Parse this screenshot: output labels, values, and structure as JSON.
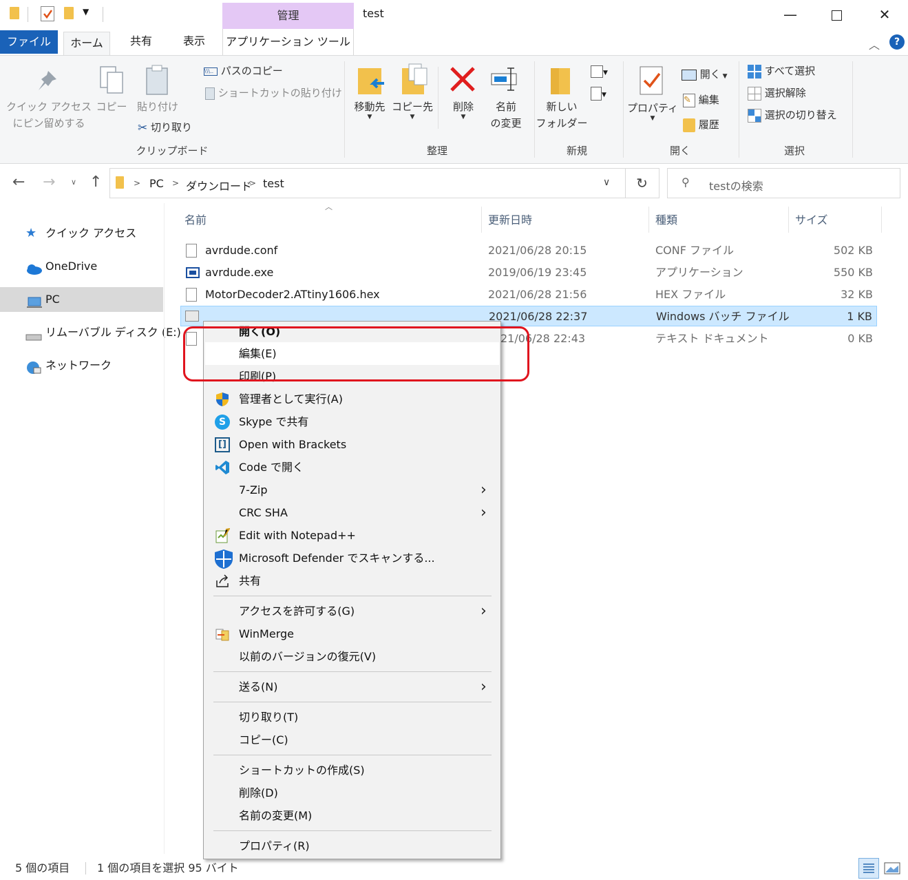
{
  "window": {
    "title": "test",
    "context_tab_header": "管理",
    "min_icon": "minimize-icon",
    "max_icon": "maximize-icon",
    "close_icon": "close-icon"
  },
  "tabs": {
    "file": "ファイル",
    "home": "ホーム",
    "share": "共有",
    "view": "表示",
    "app_tools": "アプリケーション ツール"
  },
  "ribbon": {
    "clipboard": {
      "pin_line1": "クイック アクセス",
      "pin_line2": "にピン留めする",
      "copy": "コピー",
      "paste": "貼り付け",
      "copy_path": "パスのコピー",
      "paste_shortcut": "ショートカットの貼り付け",
      "cut": "切り取り",
      "group": "クリップボード"
    },
    "organize": {
      "move_to": "移動先",
      "copy_to": "コピー先",
      "delete": "削除",
      "rename_line1": "名前",
      "rename_line2": "の変更",
      "group": "整理"
    },
    "new": {
      "new_folder_line1": "新しい",
      "new_folder_line2": "フォルダー",
      "group": "新規"
    },
    "open": {
      "properties": "プロパティ",
      "open": "開く",
      "edit": "編集",
      "history": "履歴",
      "group": "開く"
    },
    "select": {
      "select_all": "すべて選択",
      "select_none": "選択解除",
      "invert": "選択の切り替え",
      "group": "選択"
    }
  },
  "address": {
    "crumbs": [
      "PC",
      "ダウンロード",
      "test"
    ],
    "search_placeholder": "testの検索"
  },
  "nav": {
    "quick_access": "クイック アクセス",
    "onedrive": "OneDrive",
    "pc": "PC",
    "removable": "リムーバブル ディスク (E:)",
    "network": "ネットワーク"
  },
  "columns": {
    "name": "名前",
    "modified": "更新日時",
    "type": "種類",
    "size": "サイズ"
  },
  "files": [
    {
      "name": "avrdude.conf",
      "modified": "2021/06/28 20:15",
      "type": "CONF ファイル",
      "size": "502 KB"
    },
    {
      "name": "avrdude.exe",
      "modified": "2019/06/19 23:45",
      "type": "アプリケーション",
      "size": "550 KB"
    },
    {
      "name": "MotorDecoder2.ATtiny1606.hex",
      "modified": "2021/06/28 21:56",
      "type": "HEX ファイル",
      "size": "32 KB"
    },
    {
      "name": "",
      "modified": "2021/06/28 22:37",
      "type": "Windows バッチ ファイル",
      "size": "1 KB"
    },
    {
      "name": "",
      "modified": "21/06/28 22:43",
      "type": "テキスト ドキュメント",
      "size": "0 KB"
    }
  ],
  "context_menu": {
    "open": "開く(O)",
    "edit": "編集(E)",
    "print": "印刷(P)",
    "run_as_admin": "管理者として実行(A)",
    "skype": "Skype で共有",
    "brackets": "Open with Brackets",
    "code": "Code で開く",
    "zip": "7-Zip",
    "crc": "CRC SHA",
    "notepadpp": "Edit with Notepad++",
    "defender": "Microsoft Defender でスキャンする...",
    "share": "共有",
    "give_access": "アクセスを許可する(G)",
    "winmerge": "WinMerge",
    "restore": "以前のバージョンの復元(V)",
    "send_to": "送る(N)",
    "cut": "切り取り(T)",
    "copy": "コピー(C)",
    "create_shortcut": "ショートカットの作成(S)",
    "delete": "削除(D)",
    "rename": "名前の変更(M)",
    "properties": "プロパティ(R)"
  },
  "status": {
    "count": "5 個の項目",
    "selection": "1 個の項目を選択  95 バイト"
  },
  "colors": {
    "file_tab": "#1a62b8",
    "context_tab": "#e4c8f5",
    "selection": "#cce8ff",
    "highlight_box": "#e0141e"
  }
}
